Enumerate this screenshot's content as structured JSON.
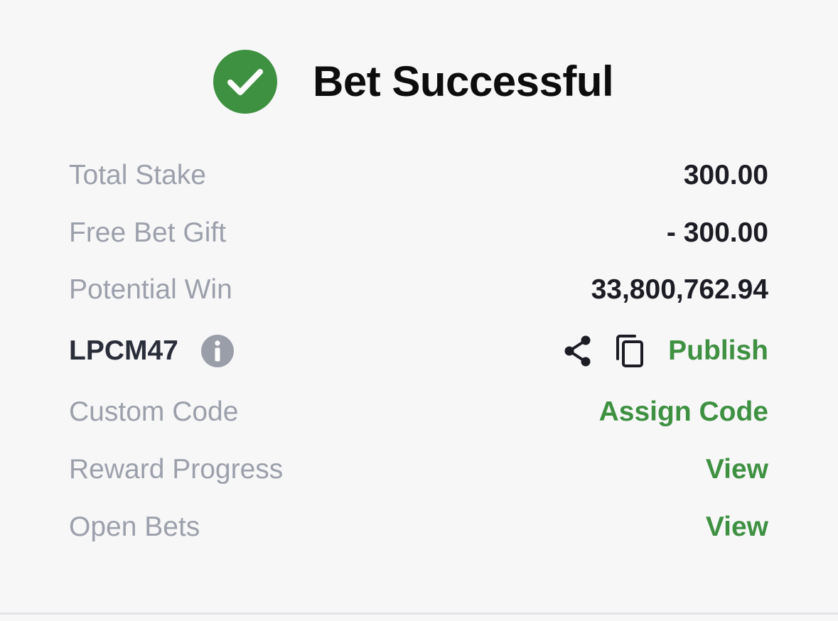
{
  "header": {
    "title": "Bet Successful",
    "icon": "check-circle-icon",
    "icon_color": "#3f9142"
  },
  "summary": {
    "total_stake_label": "Total Stake",
    "total_stake_value": "300.00",
    "free_bet_label": "Free Bet Gift",
    "free_bet_value": "- 300.00",
    "potential_win_label": "Potential Win",
    "potential_win_value": "33,800,762.94"
  },
  "booking": {
    "code": "LPCM47",
    "info_icon": "info-icon",
    "share_icon": "share-icon",
    "copy_icon": "copy-icon",
    "publish_label": "Publish"
  },
  "custom_code": {
    "label": "Custom Code",
    "action": "Assign Code"
  },
  "reward_progress": {
    "label": "Reward Progress",
    "action": "View"
  },
  "open_bets": {
    "label": "Open Bets",
    "action": "View"
  },
  "colors": {
    "accent_green": "#3f9142",
    "label_gray": "#9ca0ab",
    "value_dark": "#1c1c24",
    "background": "#f7f7f8"
  }
}
